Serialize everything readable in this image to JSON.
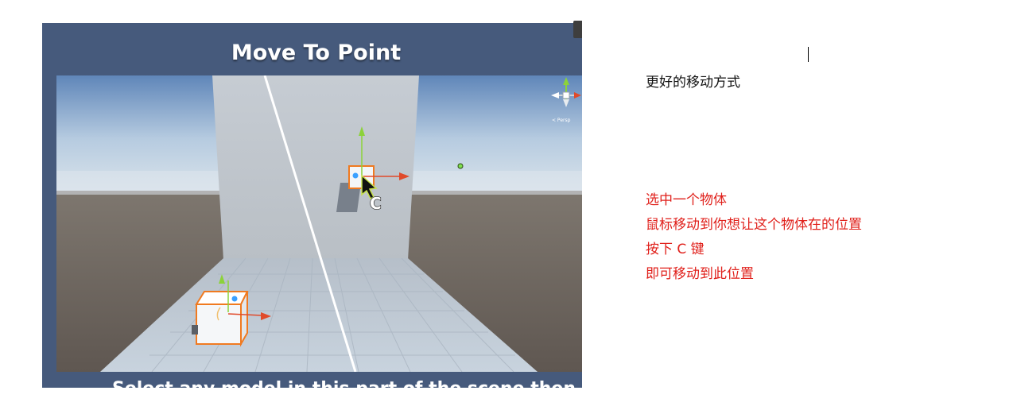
{
  "demo_image": {
    "title": "Move To Point",
    "bottom_caption": "Select any model in this part of the scene then",
    "cursor_key_label": "C",
    "gizmo_label": "< Persp"
  },
  "document": {
    "heading": "更好的移动方式",
    "steps": [
      "选中一个物体",
      "鼠标移动到你想让这个物体在的位置",
      "按下 C 键",
      "即可移动到此位置"
    ]
  },
  "colors": {
    "frame_background": "#465a7c",
    "step_text": "#e0201b",
    "heading_text": "#111111",
    "selection_outline": "#f07a20"
  }
}
